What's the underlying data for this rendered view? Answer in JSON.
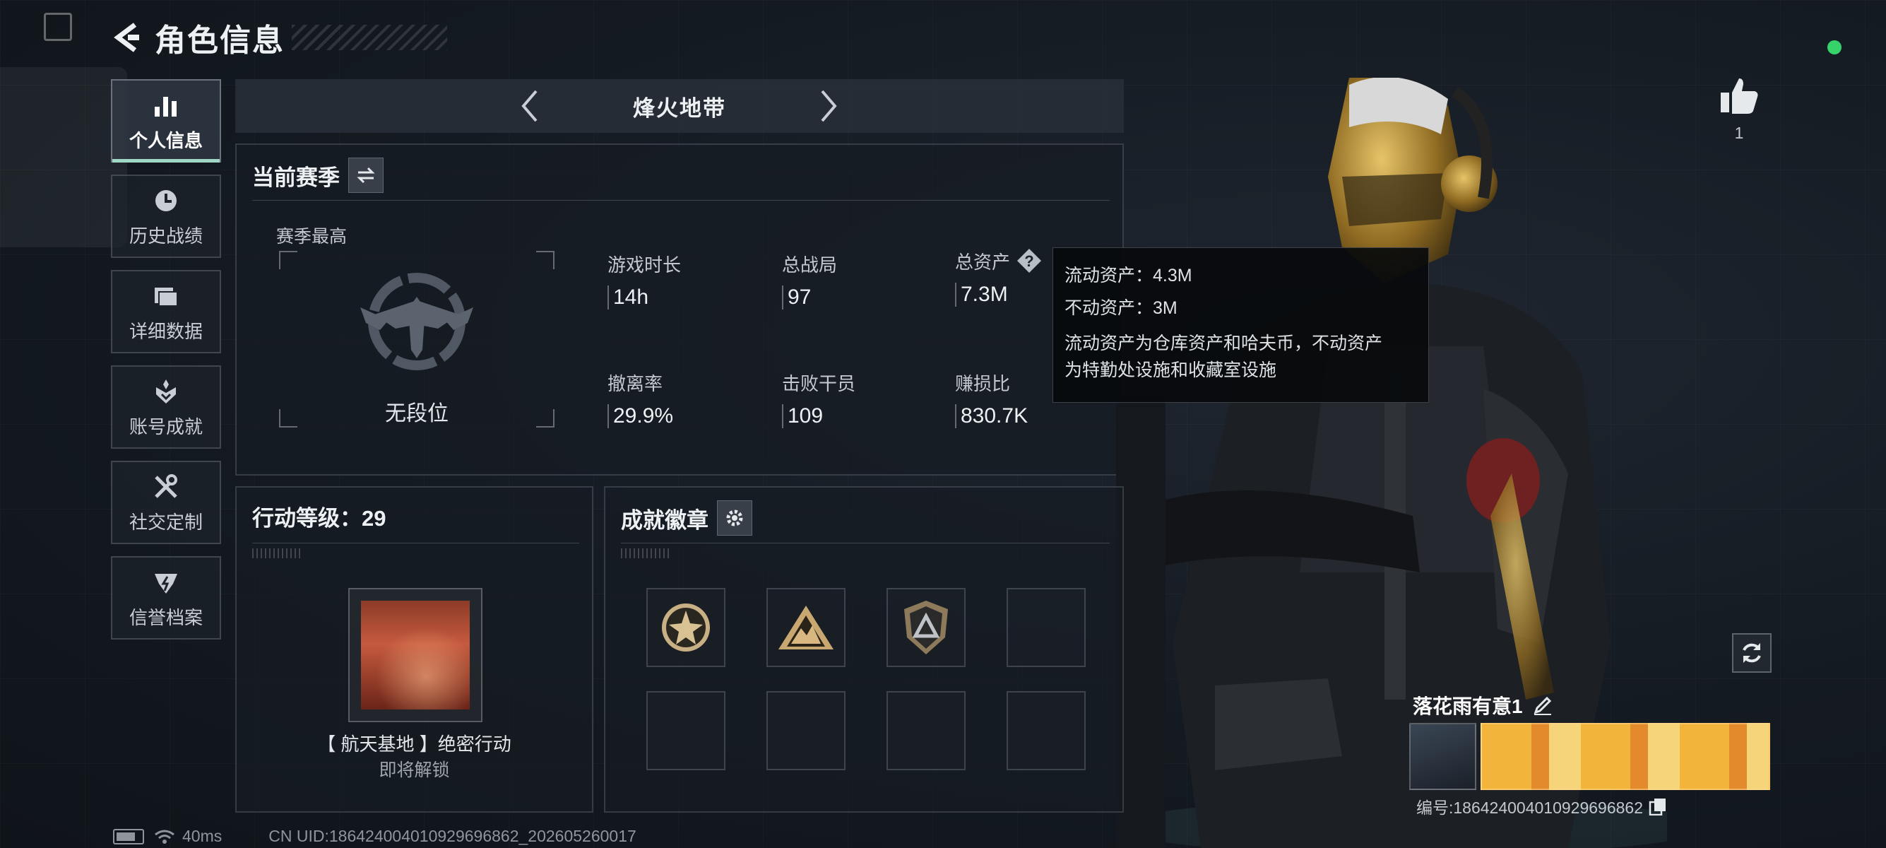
{
  "header": {
    "title": "角色信息"
  },
  "sidebar": {
    "items": [
      {
        "label": "个人信息",
        "icon": "bar-chart-icon",
        "active": true
      },
      {
        "label": "历史战绩",
        "icon": "history-icon"
      },
      {
        "label": "详细数据",
        "icon": "folder-icon"
      },
      {
        "label": "账号成就",
        "icon": "achievement-icon"
      },
      {
        "label": "社交定制",
        "icon": "tools-icon"
      },
      {
        "label": "信誉档案",
        "icon": "credit-icon"
      }
    ]
  },
  "mode": {
    "title": "烽火地带"
  },
  "season": {
    "title": "当前赛季",
    "best_label": "赛季最高",
    "rank_name": "无段位",
    "stats": [
      {
        "label": "游戏时长",
        "value": "14h"
      },
      {
        "label": "总战局",
        "value": "97"
      },
      {
        "label": "总资产",
        "value": "7.3M"
      },
      {
        "label": "撤离率",
        "value": "29.9%"
      },
      {
        "label": "击败干员",
        "value": "109"
      },
      {
        "label": "赚损比",
        "value": "830.7K"
      }
    ]
  },
  "tooltip": {
    "liquid": "流动资产：4.3M",
    "fixed": "不动资产：3M",
    "desc_line1": "流动资产为仓库资产和哈夫币，不动资产",
    "desc_line2": "为特勤处设施和收藏室设施"
  },
  "level": {
    "title": "行动等级：29",
    "mission_name": "【 航天基地 】绝密行动",
    "mission_status": "即将解锁"
  },
  "achievements": {
    "title": "成就徽章",
    "badges": [
      "star-badge-icon",
      "mountain-badge-icon",
      "shield-badge-icon"
    ]
  },
  "profile": {
    "likes": "1",
    "player_name": "落花雨有意1",
    "player_id": "编号:18642400401092969686​2"
  },
  "footer": {
    "latency": "40ms",
    "uid": "CN UID:18642400401092969686​2_202605260017"
  },
  "colors": {
    "accent": "#9fd8c7",
    "online": "#36d36b",
    "background": "#141a21"
  }
}
